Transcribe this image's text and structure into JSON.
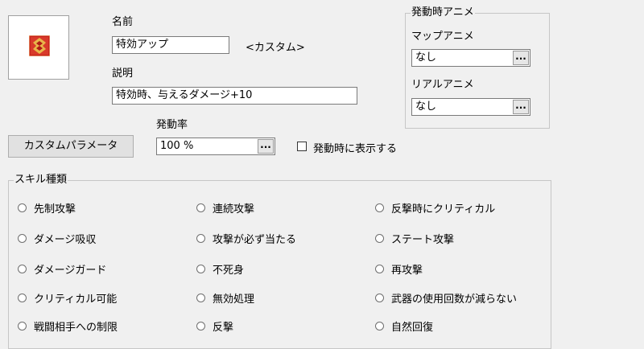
{
  "icon": {
    "name": "skill-icon"
  },
  "name_section": {
    "label": "名前",
    "value": "特効アップ",
    "custom_tag": "<カスタム>"
  },
  "description_section": {
    "label": "説明",
    "value": "特効時、与えるダメージ+10"
  },
  "activation_anime": {
    "group_title": "発動時アニメ",
    "map_label": "マップアニメ",
    "map_value": "なし",
    "real_label": "リアルアニメ",
    "real_value": "なし",
    "dots": "..."
  },
  "custom_param_button": "カスタムパラメータ",
  "activation_rate": {
    "label": "発動率",
    "value": "100 %",
    "dots": "..."
  },
  "show_on_activate": {
    "label": "発動時に表示する",
    "checked": false
  },
  "skill_types": {
    "group_title": "スキル種類",
    "items": [
      "先制攻撃",
      "連続攻撃",
      "反撃時にクリティカル",
      "ダメージ吸収",
      "攻撃が必ず当たる",
      "ステート攻撃",
      "ダメージガード",
      "不死身",
      "再攻撃",
      "クリティカル可能",
      "無効処理",
      "武器の使用回数が減らない",
      "戦闘相手への制限",
      "反撃",
      "自然回復"
    ]
  },
  "colors": {
    "window_bg": "#f0f0f0",
    "border": "#c6c6c6",
    "icon_red": "#c8231e",
    "icon_gold": "#e8b64a"
  }
}
